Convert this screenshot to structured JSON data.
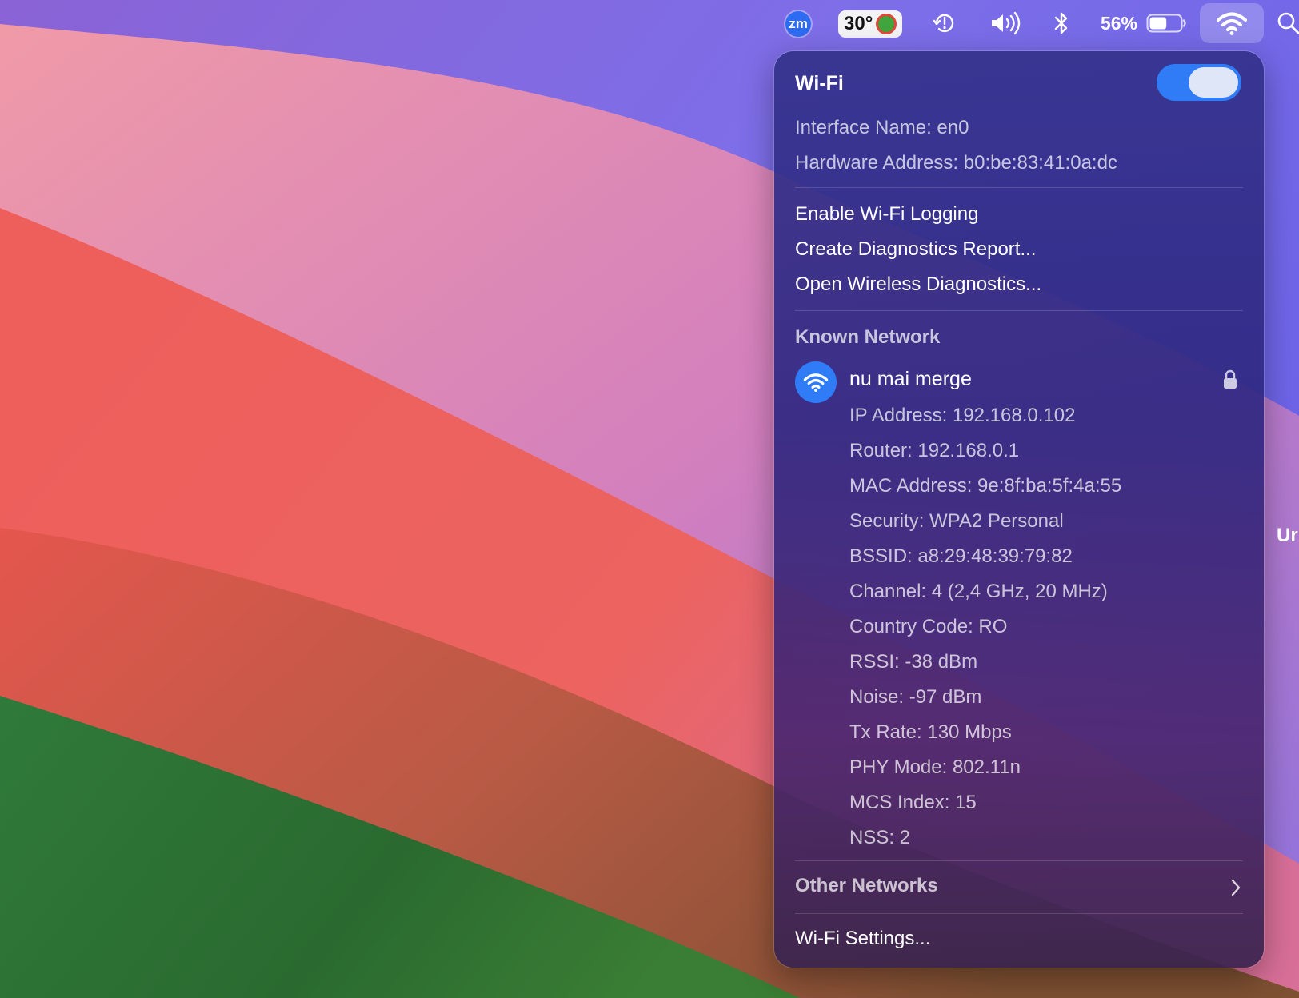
{
  "menubar": {
    "zoom_label": "zm",
    "temperature": "30°",
    "battery_percent": "56%",
    "battery_level": 0.56,
    "icons": [
      "zoom-icon",
      "weather-icon",
      "time-machine-icon",
      "volume-icon",
      "bluetooth-icon",
      "battery-icon",
      "wifi-icon",
      "spotlight-search-icon"
    ]
  },
  "panel": {
    "title": "Wi-Fi",
    "toggle_on": true,
    "interface_name": "Interface Name: en0",
    "hardware_address": "Hardware Address: b0:be:83:41:0a:dc",
    "menu_items": [
      "Enable Wi-Fi Logging",
      "Create Diagnostics Report...",
      "Open Wireless Diagnostics..."
    ],
    "known_network_header": "Known Network",
    "network": {
      "name": "nu mai merge",
      "details": [
        "IP Address: 192.168.0.102",
        "Router: 192.168.0.1",
        "MAC Address: 9e:8f:ba:5f:4a:55",
        "Security: WPA2 Personal",
        "BSSID: a8:29:48:39:79:82",
        "Channel: 4 (2,4 GHz, 20 MHz)",
        "Country Code: RO",
        "RSSI: -38 dBm",
        "Noise: -97 dBm",
        "Tx Rate: 130 Mbps",
        "PHY Mode: 802.11n",
        "MCS Index: 15",
        "NSS: 2"
      ]
    },
    "other_networks": "Other Networks",
    "settings": "Wi-Fi Settings..."
  },
  "edge_text": "Ur",
  "colors": {
    "accent": "#2f7cf6"
  }
}
